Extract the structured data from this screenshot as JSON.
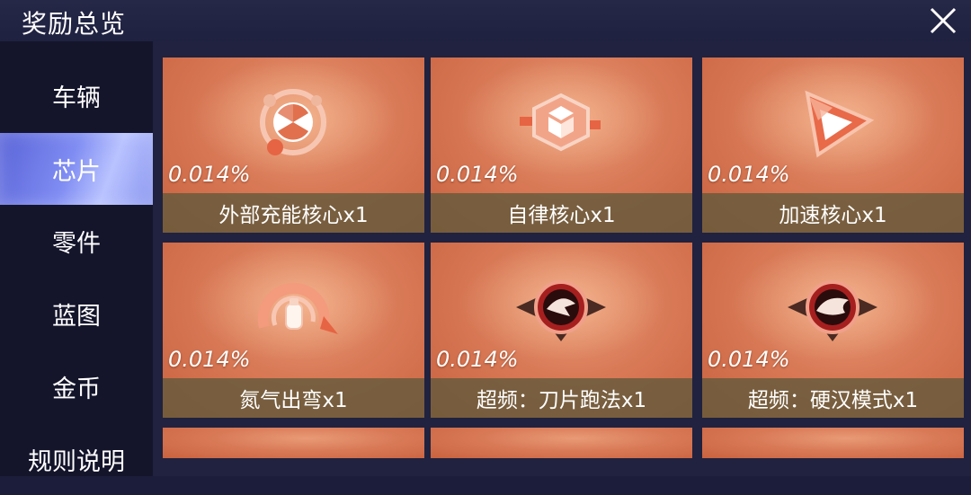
{
  "header": {
    "title": "奖励总览",
    "close_icon": "close-icon"
  },
  "sidebar": {
    "items": [
      {
        "label": "车辆",
        "active": false
      },
      {
        "label": "芯片",
        "active": true
      },
      {
        "label": "零件",
        "active": false
      },
      {
        "label": "蓝图",
        "active": false
      },
      {
        "label": "金币",
        "active": false
      },
      {
        "label": "规则说明",
        "active": false
      }
    ]
  },
  "rewards": [
    {
      "name": "外部充能核心x1",
      "probability": "0.014%",
      "icon": "radiation-core-icon"
    },
    {
      "name": "自律核心x1",
      "probability": "0.014%",
      "icon": "hexagon-core-icon"
    },
    {
      "name": "加速核心x1",
      "probability": "0.014%",
      "icon": "triangle-boost-icon"
    },
    {
      "name": "氮气出弯x1",
      "probability": "0.014%",
      "icon": "nitro-curve-icon"
    },
    {
      "name": "超频：刀片跑法x1",
      "probability": "0.014%",
      "icon": "blade-overclock-icon"
    },
    {
      "name": "超频：硬汉模式x1",
      "probability": "0.014%",
      "icon": "tough-overclock-icon"
    }
  ],
  "colors": {
    "accent": "#7f8cf2",
    "card": "#d97a57",
    "label_bar": "#645a3c"
  }
}
